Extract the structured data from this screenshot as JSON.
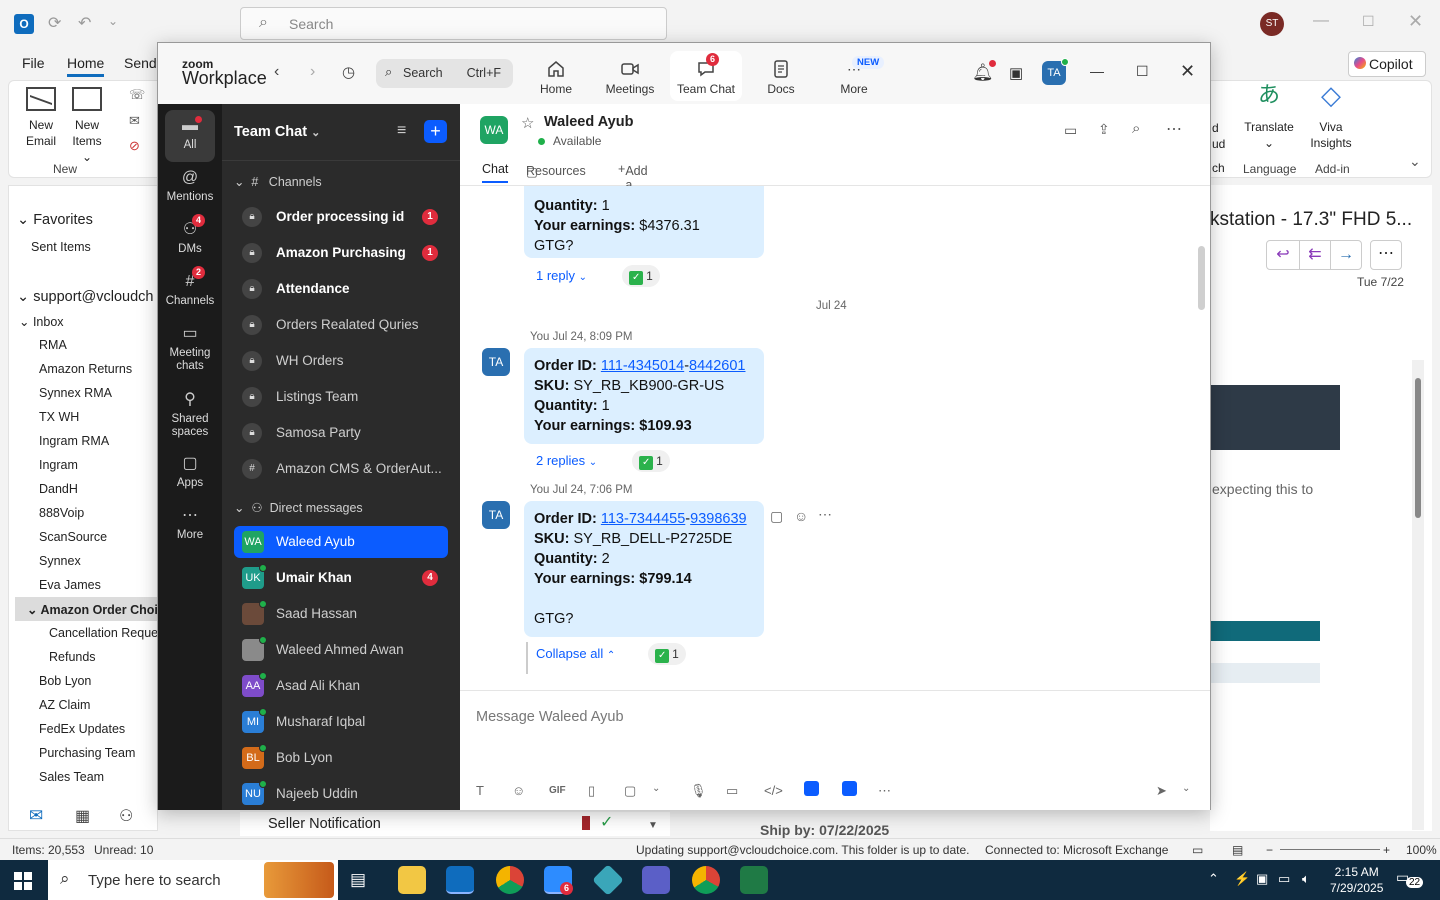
{
  "outlook": {
    "search_placeholder": "Search",
    "user_initials": "ST",
    "menu": [
      "File",
      "Home",
      "Send"
    ],
    "copilot": "Copilot",
    "ribbon": {
      "new_email": "New\nEmail",
      "new_email_a": "New",
      "new_email_b": "Email",
      "new_items_a": "New",
      "new_items_b": "Items",
      "group_new": "New",
      "translate": "Translate",
      "viva_a": "Viva",
      "viva_b": "Insights",
      "group_language": "Language",
      "group_addin": "Add-in",
      "partial_a": "d",
      "partial_b": "ud",
      "partial_c": "ch"
    },
    "nav": {
      "favorites": "Favorites",
      "sent_items": "Sent Items",
      "account": "support@vcloudch",
      "inbox": "Inbox",
      "folders": [
        "RMA",
        "Amazon Returns",
        "Synnex RMA",
        "TX WH",
        "Ingram RMA",
        "Ingram",
        "DandH",
        "888Voip",
        "ScanSource",
        "Synnex",
        "Eva James"
      ],
      "amazon_order": "Amazon Order Choice",
      "sub_folders": [
        "Cancellation Request",
        "Refunds"
      ],
      "more_folders": [
        "Bob Lyon",
        "AZ Claim",
        "FedEx Updates",
        "Purchasing Team",
        "Sales Team"
      ]
    },
    "reading": {
      "subject": "kstation - 17.3\" FHD 5...",
      "date": "Tue 7/22",
      "snippet": "expecting this to"
    },
    "list_peek": {
      "seller": "Seller Notification",
      "ship_by": "Ship by: 07/22/2025"
    },
    "status": {
      "items": "Items: 20,553",
      "unread": "Unread: 10",
      "updating": "Updating support@vcloudchoice.com. This folder is up to date.",
      "connected": "Connected to: Microsoft Exchange",
      "zoom": "100%"
    }
  },
  "zoom": {
    "logo_small": "zoom",
    "logo_big": "Workplace",
    "search_label": "Search",
    "search_shortcut": "Ctrl+F",
    "tabs": [
      {
        "label": "Home"
      },
      {
        "label": "Meetings"
      },
      {
        "label": "Team Chat",
        "badge": "6"
      },
      {
        "label": "Docs"
      },
      {
        "label": "More",
        "new": "NEW"
      }
    ],
    "avatar_initials": "TA",
    "rail": [
      {
        "label": "All"
      },
      {
        "label": "Mentions"
      },
      {
        "label": "DMs",
        "badge": "4"
      },
      {
        "label": "Channels",
        "badge": "2"
      },
      {
        "label": "Meeting chats",
        "l1": "Meeting",
        "l2": "chats"
      },
      {
        "label": "Shared spaces",
        "l1": "Shared",
        "l2": "spaces"
      },
      {
        "label": "Apps"
      },
      {
        "label": "More"
      }
    ],
    "sidebar": {
      "title": "Team Chat",
      "channels_head": "Channels",
      "channels": [
        {
          "name": "Order processing id",
          "badge": "1"
        },
        {
          "name": "Amazon Purchasing",
          "badge": "1"
        },
        {
          "name": "Attendance"
        },
        {
          "name": "Orders Realated Quries"
        },
        {
          "name": "WH Orders"
        },
        {
          "name": "Listings Team"
        },
        {
          "name": "Samosa Party"
        },
        {
          "name": "Amazon CMS & OrderAut..."
        }
      ],
      "dm_head": "Direct messages",
      "dms": [
        {
          "name": "Waleed Ayub",
          "initials": "WA",
          "color": "#1fa463"
        },
        {
          "name": "Umair Khan",
          "initials": "UK",
          "color": "#1f9c8a",
          "badge": "4"
        },
        {
          "name": "Saad Hassan",
          "initials": "",
          "color": "#6b4a3a"
        },
        {
          "name": "Waleed Ahmed Awan",
          "initials": "",
          "color": "#8a8a8a"
        },
        {
          "name": "Asad Ali Khan",
          "initials": "AA",
          "color": "#7e4cc9"
        },
        {
          "name": "Musharaf Iqbal",
          "initials": "MI",
          "color": "#2a7ed6"
        },
        {
          "name": "Bob Lyon",
          "initials": "BL",
          "color": "#d36b1a"
        },
        {
          "name": "Najeeb Uddin",
          "initials": "NU",
          "color": "#2a7ed6"
        }
      ]
    },
    "chat": {
      "initials": "WA",
      "name": "Waleed Ayub",
      "status": "Available",
      "tab_chat": "Chat",
      "tab_resources": "Resources",
      "tab_add": "Add a tab",
      "msg0": {
        "quantity_label": "Quantity:",
        "quantity": " 1",
        "earnings_label": "Your earnings:",
        "earnings": " $4376.31",
        "note": "GTG?",
        "replies": "1 reply",
        "reaction_count": "1"
      },
      "date_sep": "Jul 24",
      "msg1": {
        "meta": "You Jul 24, 8:09 PM",
        "avatar": "TA",
        "order_label": "Order ID:",
        "order_a": "111-4345014",
        "order_b": "8442601",
        "sku_label": "SKU:",
        "sku": " SY_RB_KB900-GR-US",
        "quantity_label": "Quantity:",
        "quantity": " 1",
        "earnings_label": "Your earnings: $109.93",
        "replies": "2 replies",
        "reaction_count": "1"
      },
      "msg2": {
        "meta": "You Jul 24, 7:06 PM",
        "avatar": "TA",
        "order_label": "Order ID:",
        "order_a": "113-7344455",
        "order_b": "9398639",
        "sku_label": "SKU:",
        "sku": " SY_RB_DELL-P2725DE",
        "quantity_label": "Quantity:",
        "quantity": " 2",
        "earnings_label": "Your earnings: $799.14",
        "note": "GTG?",
        "collapse": "Collapse all",
        "reaction_count": "1"
      },
      "compose_placeholder": "Message Waleed Ayub",
      "gif": "GIF"
    }
  },
  "taskbar": {
    "search_placeholder": "Type here to search",
    "time": "2:15 AM",
    "date": "7/29/2025",
    "zoom_badge": "6",
    "notif_count": "22"
  }
}
